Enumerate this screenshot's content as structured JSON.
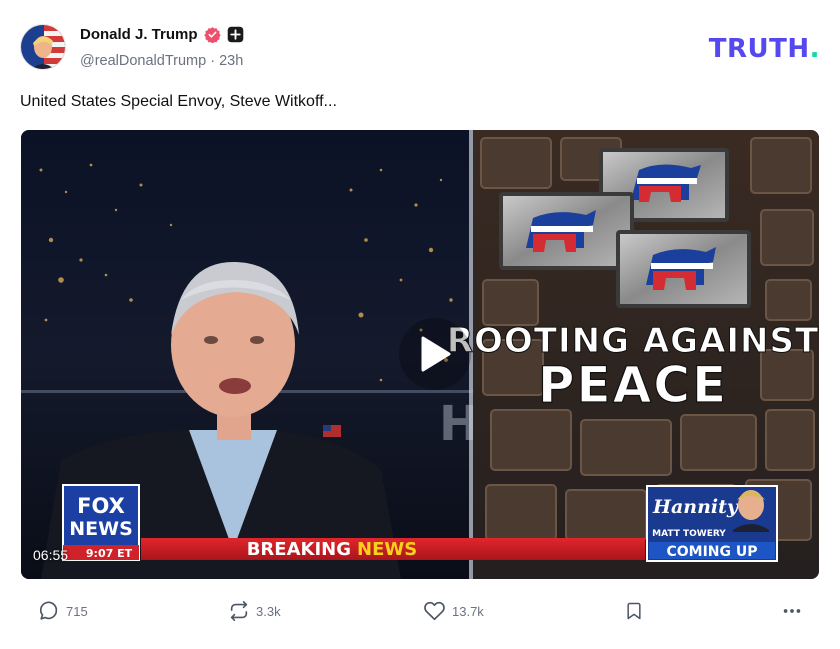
{
  "author": {
    "display_name": "Donald J. Trump",
    "handle": "@realDonaldTrump",
    "separator": "·",
    "time_ago": "23h",
    "verified_icon": "verified-badge-icon",
    "verified_color": "#f04f6b",
    "subscription_icon": "plus-badge-icon"
  },
  "brand": {
    "logo_text": "TRUTH",
    "logo_dot": ".",
    "primary_color": "#5448ee",
    "dot_color": "#1dd3a7"
  },
  "post": {
    "text": "United States Special Envoy, Steve Witkoff..."
  },
  "video": {
    "duration": "06:55",
    "play_icon": "play-icon",
    "overlay": {
      "headline_line1": "ROOTING AGAINST",
      "headline_line2": "PEACE",
      "network_line1": "FOX",
      "network_line2": "NEWS",
      "network_time": "9:07 ET",
      "breaking_word1": "BREAKING",
      "breaking_word2": "NEWS",
      "show_name": "Hannity",
      "promo_name": "MATT TOWERY",
      "promo_status": "COMING UP",
      "background_letters": "Ha"
    }
  },
  "actions": {
    "replies": "715",
    "retruths": "3.3k",
    "likes": "13.7k",
    "reply_icon": "comment-icon",
    "retruth_icon": "repost-icon",
    "like_icon": "heart-icon",
    "bookmark_icon": "bookmark-icon",
    "more_icon": "more-icon"
  }
}
